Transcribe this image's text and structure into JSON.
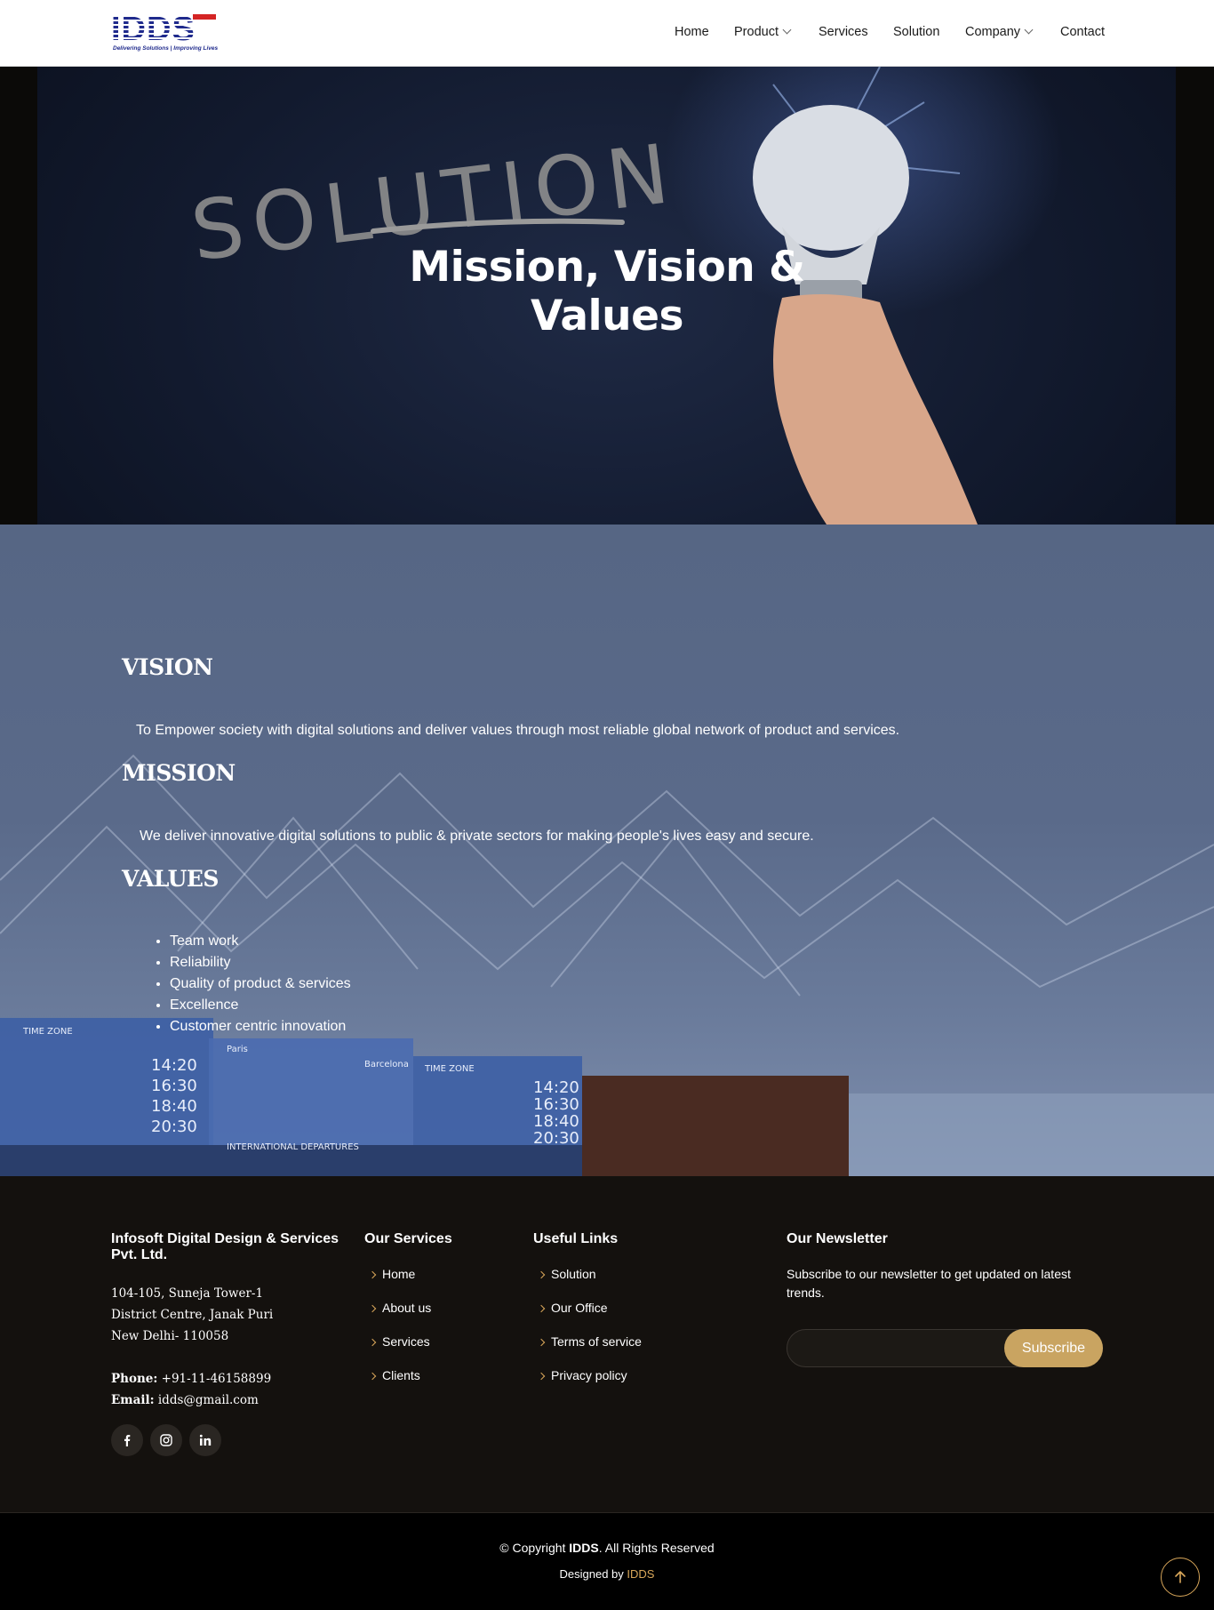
{
  "header": {
    "logo_text": "IDDS",
    "logo_tagline": "Delivering Solutions | Improving Lives",
    "nav": {
      "home": "Home",
      "product": "Product",
      "services": "Services",
      "solution": "Solution",
      "company": "Company",
      "contact": "Contact"
    }
  },
  "hero": {
    "image_text": "SOLUTION",
    "title": "Mission, Vision & Values"
  },
  "content": {
    "vision_heading": "VISION",
    "vision_text": "To Empower society with digital solutions and deliver values through most reliable global network of product and services.",
    "mission_heading": "MISSION",
    "mission_text": "We deliver innovative digital solutions to public & private sectors for making people's lives easy and secure.",
    "values_heading": "VALUES",
    "values": [
      "Team work",
      "Reliability",
      "Quality of product & services",
      "Excellence",
      "Customer centric innovation"
    ]
  },
  "footer": {
    "company_name_line1": "Infosoft Digital Design & Services",
    "company_name_line2": "Pvt. Ltd.",
    "address": [
      "104-105, Suneja Tower-1",
      "District Centre, Janak Puri",
      "New Delhi- 110058"
    ],
    "phone_label": "Phone:",
    "phone": "+91-11-46158899",
    "email_label": "Email:",
    "email": "idds@gmail.com",
    "services_title": "Our Services",
    "services_links": [
      "Home",
      "About us",
      "Services",
      "Clients"
    ],
    "useful_title": "Useful Links",
    "useful_links": [
      "Solution",
      "Our Office",
      "Terms of service",
      "Privacy policy"
    ],
    "newsletter_title": "Our Newsletter",
    "newsletter_text": "Subscribe to our newsletter to get updated on latest trends.",
    "newsletter_input_value": "",
    "subscribe_label": "Subscribe",
    "copyright_prefix": "© Copyright ",
    "copyright_brand": "IDDS",
    "copyright_suffix": ". All Rights Reserved",
    "designed_prefix": "Designed by ",
    "designed_brand": "IDDS"
  },
  "icons": {
    "social": [
      "facebook-icon",
      "instagram-icon",
      "linkedin-icon"
    ],
    "back_to_top": "arrow-up-icon"
  },
  "colors": {
    "accent": "#c9a461",
    "logo_blue": "#1f2a8c",
    "logo_red": "#d42424",
    "footer_bg": "#14110e"
  }
}
